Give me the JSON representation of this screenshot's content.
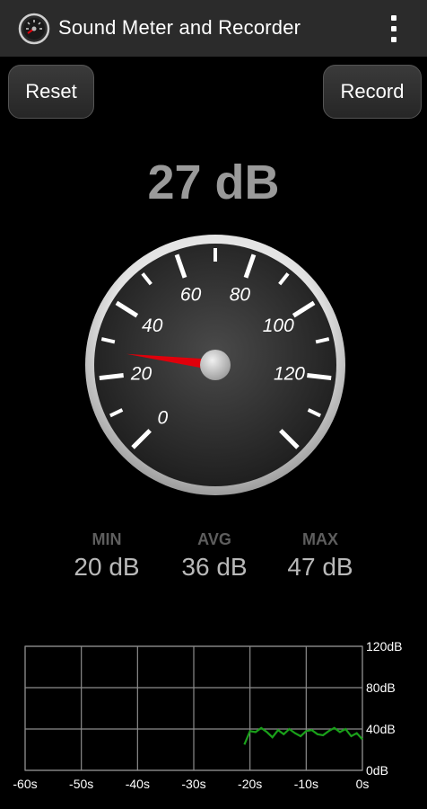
{
  "app": {
    "title": "Sound Meter and Recorder",
    "icon": "speedometer-icon",
    "menu_icon": "more-vert-icon"
  },
  "toolbar": {
    "reset_label": "Reset",
    "record_label": "Record"
  },
  "current_reading": "27 dB",
  "gauge": {
    "value_db": 27,
    "scale_labels": [
      "0",
      "20",
      "40",
      "60",
      "80",
      "100",
      "120"
    ],
    "needle_color": "#e0000b"
  },
  "stats": [
    {
      "label": "MIN",
      "value": "20 dB"
    },
    {
      "label": "AVG",
      "value": "36 dB"
    },
    {
      "label": "MAX",
      "value": "47 dB"
    }
  ],
  "chart_data": {
    "type": "line",
    "x_ticks": [
      "-60s",
      "-50s",
      "-40s",
      "-30s",
      "-20s",
      "-10s",
      "0s"
    ],
    "y_ticks": [
      "120dB",
      "80dB",
      "40dB",
      "0dB"
    ],
    "xlim": [
      -60,
      0
    ],
    "ylim": [
      0,
      120
    ],
    "grid": true,
    "series": [
      {
        "color": "#1aa01a",
        "x": [
          -21,
          -20,
          -19,
          -18,
          -17,
          -16,
          -15,
          -14,
          -13,
          -12,
          -11,
          -10,
          -9,
          -8,
          -7,
          -6,
          -5,
          -4,
          -3,
          -2,
          -1,
          0
        ],
        "values": [
          25,
          38,
          37,
          41,
          37,
          32,
          39,
          35,
          40,
          36,
          33,
          38,
          39,
          35,
          34,
          38,
          41,
          37,
          40,
          33,
          36,
          30
        ]
      }
    ]
  }
}
